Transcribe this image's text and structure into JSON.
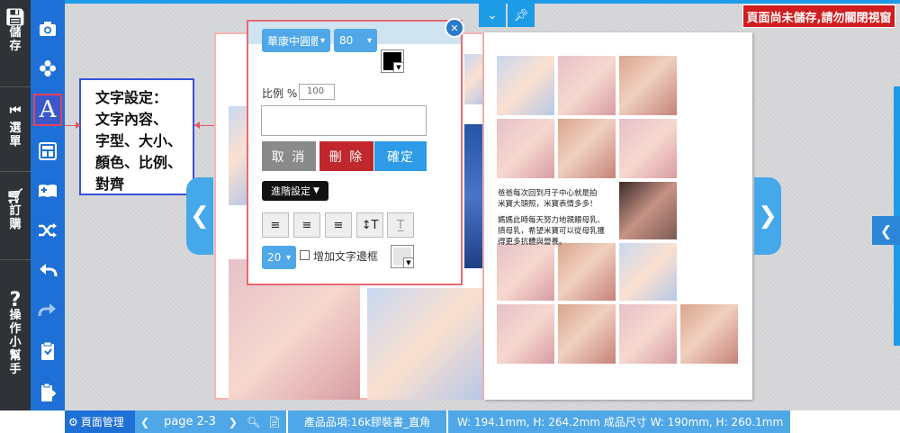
{
  "left_rail": {
    "save_label": [
      "儲",
      "存"
    ],
    "menu_label": [
      "選",
      "單"
    ],
    "order_label": [
      "訂",
      "購"
    ],
    "help_label": [
      "操",
      "作",
      "小",
      "幫",
      "手"
    ]
  },
  "tools": [
    "camera-icon",
    "flower-icon",
    "text-icon",
    "layout-icon",
    "add-album-icon",
    "shuffle-icon",
    "undo-icon",
    "redo-icon",
    "paste-icon",
    "clipboard-icon"
  ],
  "callout": {
    "lines": [
      "文字設定：",
      "文字內容、",
      "字型、大小、",
      "顏色、比例、",
      "對齊"
    ]
  },
  "warning": "頁面尚未儲存,請勿關閉視窗",
  "dialog": {
    "font_select": "華康中圓體",
    "size_select": "80",
    "ratio_label": "比例 %",
    "ratio_placeholder": "100",
    "cancel": "取 消",
    "delete": "刪 除",
    "confirm": "確定",
    "advanced": "進階設定",
    "line_size": "20",
    "border_label": "增加文字邊框",
    "colors": {
      "text": "#000000",
      "border": "#888888"
    }
  },
  "page_caption": {
    "line1": "爸爸每次回到月子中心就是拍",
    "line2": "米寶大頭照，米寶表情多多！",
    "line3": "媽媽此時每天努力地親餵母乳、",
    "line4": "擠母乳，希望米寶可以從母乳獲",
    "line5": "得更多抗體與營養。"
  },
  "bottom": {
    "page_manage": "頁面管理",
    "page": "page 2-3",
    "product": "產品品項:16k膠裝書_直角",
    "size": "W: 194.1mm, H: 264.2mm  成品尺寸 W: 190mm, H: 260.1mm"
  },
  "colors": {
    "accent": "#1e9be6",
    "tool_bg": "#1e6fd6",
    "warn": "#cf1d20"
  }
}
